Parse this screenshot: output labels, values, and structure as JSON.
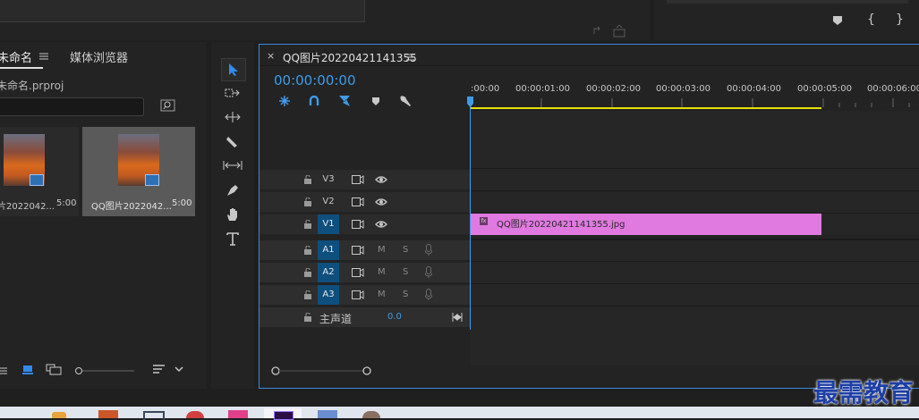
{
  "project_panel": {
    "tabs": [
      {
        "label": "未命名"
      },
      {
        "label": "媒体浏览器"
      }
    ],
    "project_file": "未命名.prproj",
    "items": [
      {
        "name": "片2022042...",
        "duration": "5:00"
      },
      {
        "name": "QQ图片2022042...",
        "duration": "5:00"
      }
    ]
  },
  "tools": [
    "selection-tool",
    "track-select-tool",
    "ripple-edit-tool",
    "razor-tool",
    "slip-tool",
    "pen-tool",
    "hand-tool",
    "type-tool"
  ],
  "timeline": {
    "sequence_name": "QQ图片20220421141355",
    "timecode": "00:00:00:00",
    "ruler": [
      ":00:00",
      "00:00:01:00",
      "00:00:02:00",
      "00:00:03:00",
      "00:00:04:00",
      "00:00:05:00",
      "00:00:06:00"
    ],
    "video_tracks": [
      {
        "label": "V3",
        "target": false
      },
      {
        "label": "V2",
        "target": false
      },
      {
        "label": "V1",
        "target": true
      }
    ],
    "audio_tracks": [
      {
        "label": "A1",
        "m": "M",
        "s": "S"
      },
      {
        "label": "A2",
        "m": "M",
        "s": "S"
      },
      {
        "label": "A3",
        "m": "M",
        "s": "S"
      }
    ],
    "master": {
      "label": "主声道",
      "value": "0.0"
    },
    "clip": {
      "name": "QQ图片20220421141355.jpg",
      "fx": "fx",
      "color": "#e07ae0"
    }
  },
  "watermark": "最需教育",
  "colors": {
    "accent": "#3f87d8",
    "timecode": "#3f9be8",
    "clip": "#e07ae0",
    "work_area": "#e8e000"
  }
}
